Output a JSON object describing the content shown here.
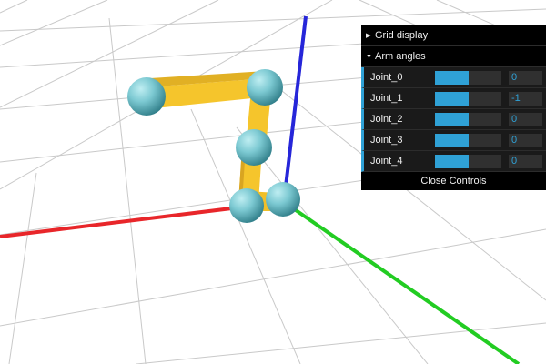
{
  "scene": {
    "colors": {
      "background": "#ffffff",
      "grid": "#c9c9c9",
      "x_axis": "#e8262a",
      "y_axis": "#2626d9",
      "z_axis": "#22cc22",
      "arm": "#f5c52c",
      "joint": "#79c8d1"
    },
    "objects": [
      "grid-plane",
      "x-axis-line",
      "y-axis-line",
      "z-axis-line",
      "robot-arm",
      "joint-spheres"
    ]
  },
  "gui": {
    "grid_display_label": "Grid display",
    "arm_angles_label": "Arm angles",
    "close_label": "Close Controls",
    "collapsed_icon": "triangle-right-icon",
    "expanded_icon": "triangle-down-icon",
    "accent": "#2fa1d6",
    "joints": [
      {
        "label": "Joint_0",
        "value": "0",
        "fill": 0.5
      },
      {
        "label": "Joint_1",
        "value": "-1",
        "fill": 0.5
      },
      {
        "label": "Joint_2",
        "value": "0",
        "fill": 0.5
      },
      {
        "label": "Joint_3",
        "value": "0",
        "fill": 0.5
      },
      {
        "label": "Joint_4",
        "value": "0",
        "fill": 0.5
      }
    ]
  }
}
